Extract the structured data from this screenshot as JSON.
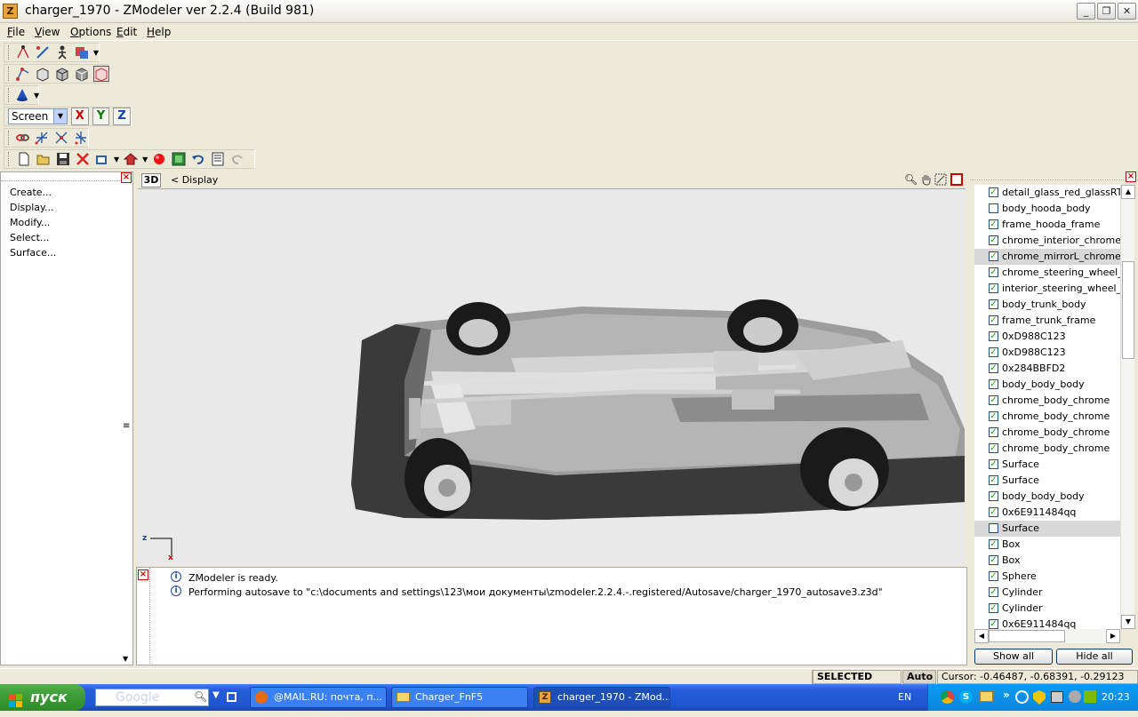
{
  "window": {
    "title": "charger_1970 - ZModeler ver 2.2.4 (Build 981)",
    "app_icon_letter": "Z",
    "minimize": "_",
    "maximize": "❐",
    "close": "✕"
  },
  "menu": [
    "File",
    "View",
    "Options",
    "Edit",
    "Help"
  ],
  "toolbar": {
    "coord_system": "Screen",
    "axis_x": "X",
    "axis_y": "Y",
    "axis_z": "Z"
  },
  "left_panel": {
    "items": [
      "Create...",
      "Display...",
      "Modify...",
      "Select...",
      "Surface..."
    ]
  },
  "viewport": {
    "mode_button": "3D",
    "nav_label": "<  Display",
    "axis_z": "z",
    "axis_x": "x"
  },
  "log": {
    "lines": [
      "ZModeler is ready.",
      "Performing autosave to \"c:\\documents and settings\\123\\мои документы\\zmodeler.2.2.4.-.registered/Autosave/charger_1970_autosave3.z3d\""
    ]
  },
  "objects": [
    {
      "name": "detail_glass_red_glassRTL_",
      "checked": true,
      "selected": false
    },
    {
      "name": "body_hooda_body",
      "checked": false,
      "selected": false
    },
    {
      "name": "frame_hooda_frame",
      "checked": true,
      "selected": false
    },
    {
      "name": "chrome_interior_chrome",
      "checked": true,
      "selected": false
    },
    {
      "name": "chrome_mirrorL_chrome",
      "checked": true,
      "selected": true
    },
    {
      "name": "chrome_steering_wheel_ch",
      "checked": true,
      "selected": false
    },
    {
      "name": "interior_steering_wheel_int",
      "checked": true,
      "selected": false
    },
    {
      "name": "body_trunk_body",
      "checked": true,
      "selected": false
    },
    {
      "name": "frame_trunk_frame",
      "checked": true,
      "selected": false
    },
    {
      "name": "0xD988C123",
      "checked": true,
      "selected": false
    },
    {
      "name": "0xD988C123",
      "checked": true,
      "selected": false
    },
    {
      "name": "0x284BBFD2",
      "checked": true,
      "selected": false
    },
    {
      "name": "body_body_body",
      "checked": true,
      "selected": false
    },
    {
      "name": "chrome_body_chrome",
      "checked": true,
      "selected": false
    },
    {
      "name": "chrome_body_chrome",
      "checked": true,
      "selected": false
    },
    {
      "name": "chrome_body_chrome",
      "checked": true,
      "selected": false
    },
    {
      "name": "chrome_body_chrome",
      "checked": true,
      "selected": false
    },
    {
      "name": "Surface",
      "checked": true,
      "selected": false
    },
    {
      "name": "Surface",
      "checked": true,
      "selected": false
    },
    {
      "name": "body_body_body",
      "checked": true,
      "selected": false
    },
    {
      "name": "0x6E911484qq",
      "checked": true,
      "selected": false
    },
    {
      "name": "Surface",
      "checked": false,
      "selected": true
    },
    {
      "name": "Box",
      "checked": true,
      "selected": false
    },
    {
      "name": "Box",
      "checked": true,
      "selected": false
    },
    {
      "name": "Sphere",
      "checked": true,
      "selected": false
    },
    {
      "name": "Cylinder",
      "checked": true,
      "selected": false
    },
    {
      "name": "Cylinder",
      "checked": true,
      "selected": false
    },
    {
      "name": "0x6E911484qq",
      "checked": true,
      "selected": false
    }
  ],
  "right_buttons": {
    "show_all": "Show all",
    "hide_all": "Hide all"
  },
  "status": {
    "mode": "SELECTED MODE",
    "auto": "Auto",
    "cursor": "Cursor: -0.46487, -0.68391, -0.29123"
  },
  "taskbar": {
    "start": "пуск",
    "search_text": "Google",
    "tasks": [
      {
        "label": "@MAIL.RU: почта, п...",
        "active": false
      },
      {
        "label": "Charger_FnF5",
        "active": false
      },
      {
        "label": "charger_1970 - ZMod...",
        "active": true
      }
    ],
    "lang": "EN",
    "clock": "20:23"
  },
  "colors": {
    "check_green": "#21a121",
    "axis_x": "#cc0000",
    "axis_y": "#0a7a0a",
    "axis_z": "#1040b0",
    "xp_blue": "#245edb"
  }
}
